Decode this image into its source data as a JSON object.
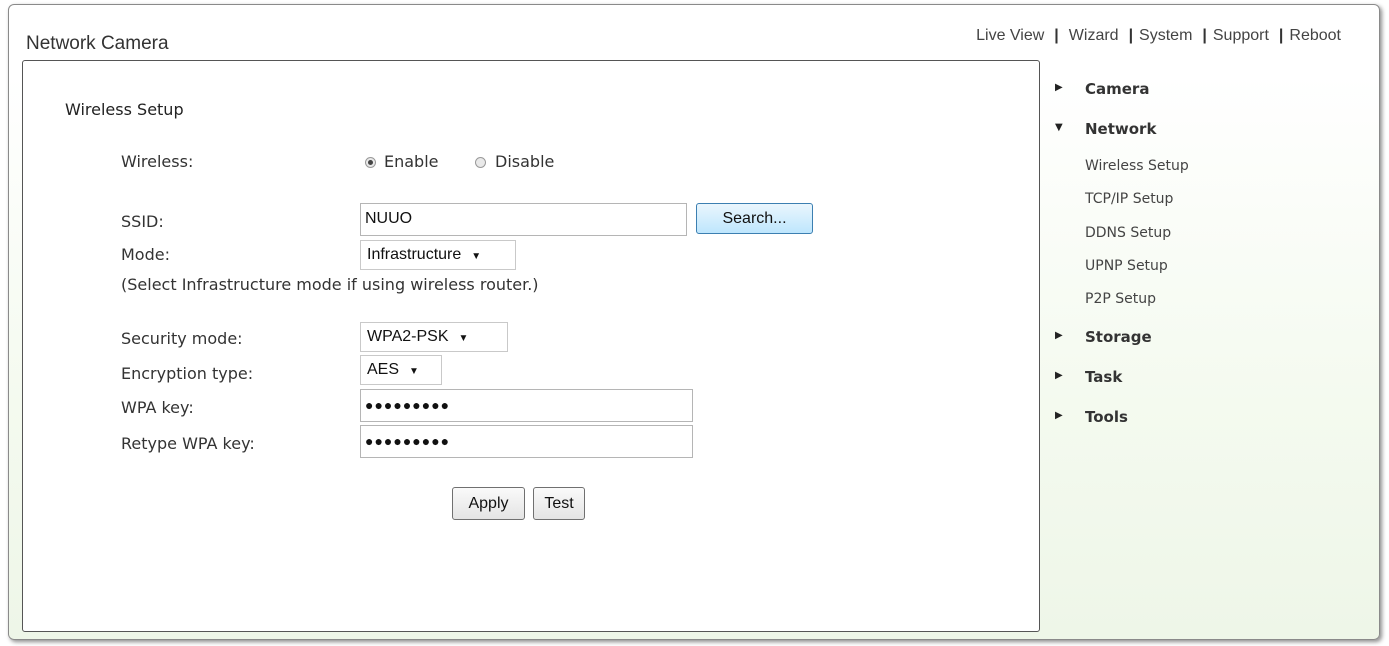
{
  "header": {
    "app_title": "Network Camera",
    "nav": [
      "Live View",
      "Wizard",
      "System",
      "Support",
      "Reboot"
    ]
  },
  "form": {
    "section_title": "Wireless Setup",
    "wireless_label": "Wireless:",
    "wireless_options": [
      "Enable",
      "Disable"
    ],
    "wireless_selected": "Enable",
    "ssid_label": "SSID:",
    "ssid_value": "NUUO",
    "search_button": "Search...",
    "mode_label": "Mode:",
    "mode_value": "Infrastructure",
    "mode_note": "(Select Infrastructure mode if using wireless router.)",
    "security_label": "Security mode:",
    "security_value": "WPA2-PSK",
    "encryption_label": "Encryption type:",
    "encryption_value": "AES",
    "wpa_key_label": "WPA key:",
    "wpa_key_value": "●●●●●●●●●",
    "retype_label": "Retype WPA key:",
    "retype_value": "●●●●●●●●●",
    "apply_button": "Apply",
    "test_button": "Test"
  },
  "sidebar": {
    "camera": "Camera",
    "network": "Network",
    "network_items": [
      "Wireless Setup",
      "TCP/IP Setup",
      "DDNS Setup",
      "UPNP Setup",
      "P2P Setup"
    ],
    "storage": "Storage",
    "task": "Task",
    "tools": "Tools"
  }
}
